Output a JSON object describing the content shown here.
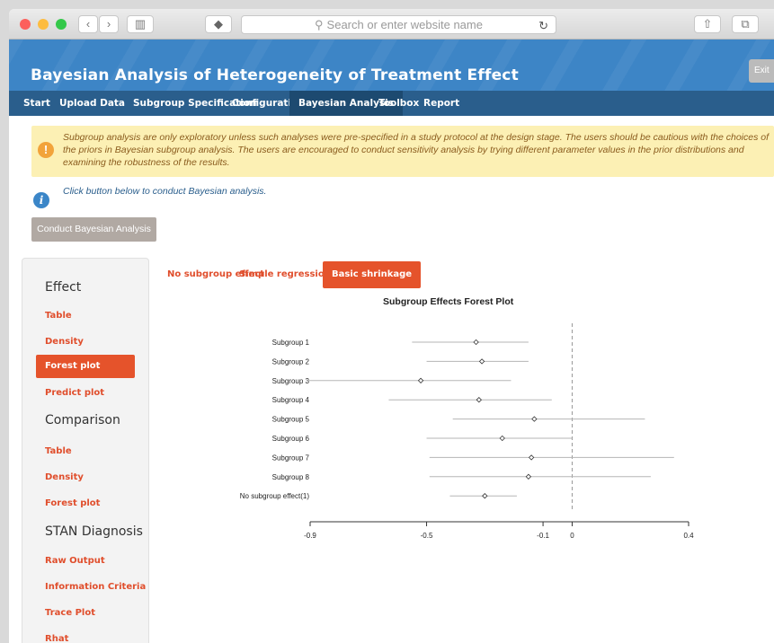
{
  "browser": {
    "url_placeholder": "Search or enter website name",
    "search_glyph": "🔍",
    "reload_glyph": "↻",
    "share_glyph": "⇧",
    "tabs_glyph": "⧉",
    "back_glyph": "‹",
    "forward_glyph": "›",
    "sidebar_glyph": "▥",
    "shield_glyph": "◆"
  },
  "app": {
    "title": "Bayesian Analysis of Heterogeneity of Treatment Effect",
    "exit_label": "Exit"
  },
  "nav": {
    "items": [
      "Start",
      "Upload Data",
      "Subgroup Specification",
      "Configuration",
      "Bayesian Analysis",
      "Toolbox",
      "Report"
    ],
    "active": "Bayesian Analysis"
  },
  "warning": {
    "icon": "!",
    "text": "Subgroup analysis are only exploratory unless such analyses were pre-specified in a study protocol at the design stage. The users should be cautious with the choices of the priors in Bayesian subgroup analysis. The users are encouraged to conduct sensitivity analysis by trying different parameter values in the prior distributions and examining the robustness of the results."
  },
  "info": {
    "icon": "i",
    "text": "Click button below to conduct Bayesian analysis."
  },
  "conduct_button": "Conduct Bayesian Analysis",
  "sidebar": {
    "effect_heading": "Effect",
    "effect_items": [
      "Table",
      "Density",
      "Forest plot",
      "Predict plot"
    ],
    "comparison_heading": "Comparison",
    "comparison_items": [
      "Table",
      "Density",
      "Forest plot"
    ],
    "stan_heading": "STAN Diagnosis",
    "stan_items": [
      "Raw Output",
      "Information Criteria",
      "Trace Plot",
      "Rhat"
    ]
  },
  "tabs": {
    "items": [
      "No subgroup effect",
      "Simple regression",
      "Basic shrinkage"
    ],
    "active": "Basic shrinkage"
  },
  "chart_data": {
    "type": "forest",
    "title": "Subgroup Effects Forest Plot",
    "categories": [
      "Subgroup 1",
      "Subgroup 2",
      "Subgroup 3",
      "Subgroup 4",
      "Subgroup 5",
      "Subgroup 6",
      "Subgroup 7",
      "Subgroup 8",
      "No subgroup effect(1)"
    ],
    "estimates": [
      -0.33,
      -0.31,
      -0.52,
      -0.32,
      -0.13,
      -0.24,
      -0.14,
      -0.15,
      -0.3
    ],
    "lower": [
      -0.55,
      -0.5,
      -0.91,
      -0.63,
      -0.41,
      -0.5,
      -0.49,
      -0.49,
      -0.42
    ],
    "upper": [
      -0.15,
      -0.15,
      -0.21,
      -0.07,
      0.25,
      0.0,
      0.35,
      0.27,
      -0.19
    ],
    "reference_line": 0,
    "xticks": [
      "-0.9",
      "-0.5",
      "-0.1",
      "0",
      "0.4"
    ],
    "xtick_values": [
      -0.9,
      -0.5,
      -0.1,
      0,
      0.4
    ],
    "xlim": [
      -0.9,
      0.4
    ]
  }
}
